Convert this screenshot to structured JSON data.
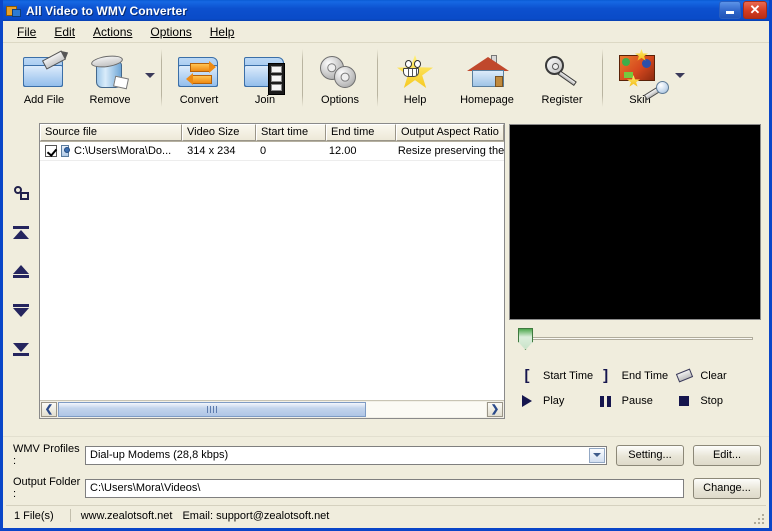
{
  "window": {
    "title": "All Video to WMV Converter",
    "icon": "app-converter-icon",
    "minimize_label": "",
    "close_label": "✕"
  },
  "menubar": {
    "items": [
      {
        "label": "File",
        "accel": "F"
      },
      {
        "label": "Edit",
        "accel": "E"
      },
      {
        "label": "Actions",
        "accel": "A"
      },
      {
        "label": "Options",
        "accel": "O"
      },
      {
        "label": "Help",
        "accel": "H"
      }
    ]
  },
  "toolbar": {
    "buttons": [
      {
        "label": "Add File",
        "icon": "folder-pencil-icon"
      },
      {
        "label": "Remove",
        "icon": "trash-can-icon",
        "has_dropdown": true
      },
      {
        "label": "Convert",
        "icon": "folder-convert-arrows-icon"
      },
      {
        "label": "Join",
        "icon": "folder-filmstrip-icon"
      },
      {
        "label": "Options",
        "icon": "gears-icon"
      },
      {
        "label": "Help",
        "icon": "smiling-star-icon"
      },
      {
        "label": "Homepage",
        "icon": "house-icon"
      },
      {
        "label": "Register",
        "icon": "key-icon"
      },
      {
        "label": "Skin",
        "icon": "skin-wand-icon",
        "has_dropdown": true
      }
    ]
  },
  "left_rail": {
    "buttons": [
      {
        "icon": "settings-gears-icon",
        "name": "file-properties"
      },
      {
        "icon": "move-to-top-icon",
        "name": "move-to-top"
      },
      {
        "icon": "move-up-icon",
        "name": "move-up"
      },
      {
        "icon": "move-down-icon",
        "name": "move-down"
      },
      {
        "icon": "move-to-bottom-icon",
        "name": "move-to-bottom"
      }
    ]
  },
  "file_list": {
    "columns": [
      "Source file",
      "Video Size",
      "Start time",
      "End time",
      "Output Aspect Ratio"
    ],
    "rows": [
      {
        "checked": true,
        "source_file": "C:\\Users\\Mora\\Do...",
        "video_size": "314 x 234",
        "start_time": "0",
        "end_time": "12.00",
        "output_aspect_ratio": "Resize preserving the"
      }
    ],
    "scroll_left_label": "❮",
    "scroll_right_label": "❯"
  },
  "preview": {
    "video_area": "black-video-preview",
    "slider_position_percent": 0,
    "controls": [
      {
        "label": "Start Time",
        "icon": "bracket-left-icon"
      },
      {
        "label": "End Time",
        "icon": "bracket-right-icon"
      },
      {
        "label": "Clear",
        "icon": "eraser-icon"
      },
      {
        "label": "Play",
        "icon": "play-icon"
      },
      {
        "label": "Pause",
        "icon": "pause-icon"
      },
      {
        "label": "Stop",
        "icon": "stop-icon"
      }
    ]
  },
  "form": {
    "profiles_label": "WMV Profiles :",
    "profiles_value": "Dial-up Modems (28,8 kbps)",
    "setting_button": "Setting...",
    "edit_button": "Edit...",
    "output_label": "Output Folder :",
    "output_value": "C:\\Users\\Mora\\Videos\\",
    "change_button": "Change..."
  },
  "statusbar": {
    "file_count": "1 File(s)",
    "website": "www.zealotsoft.net",
    "email": "Email: support@zealotsoft.net"
  },
  "colors": {
    "title_blue": "#0A4BC8",
    "toolbar_cream": "#F0EDDD",
    "close_red": "#D33C22",
    "slider_green": "#4EA84E",
    "control_navy": "#16164E"
  }
}
